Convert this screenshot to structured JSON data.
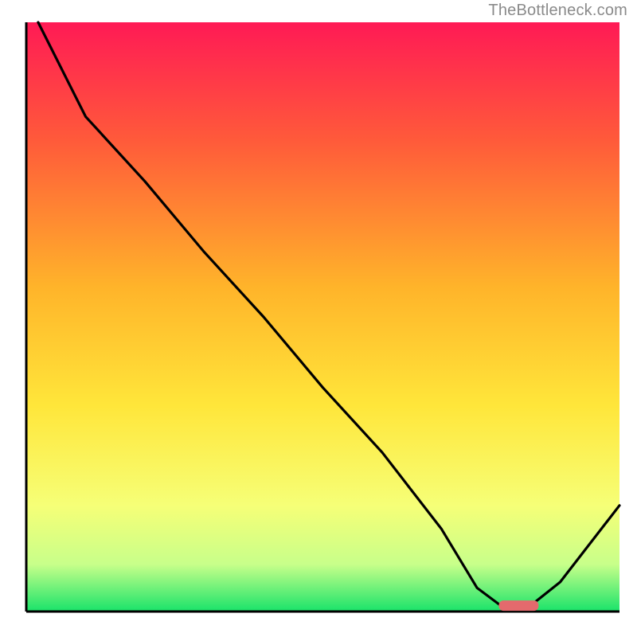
{
  "watermark": "TheBottleneck.com",
  "chart_data": {
    "type": "line",
    "title": "",
    "xlabel": "",
    "ylabel": "",
    "xlim": [
      0,
      100
    ],
    "ylim": [
      0,
      100
    ],
    "grid": false,
    "note": "Background heatmap gradient: green (bottom, good) → yellow → orange → red (top, bad). Black curve is bottleneck curve; pink marker at curve minimum.",
    "x": [
      2,
      10,
      20,
      30,
      40,
      50,
      60,
      70,
      76,
      80,
      85,
      90,
      100
    ],
    "values": [
      100,
      84,
      73,
      61,
      50,
      38,
      27,
      14,
      4,
      1,
      1,
      5,
      18
    ],
    "marker": {
      "x": 83,
      "y": 1,
      "color": "#e46a6d"
    },
    "gradient_stops": [
      {
        "pct": 0,
        "color": "#ff1a55"
      },
      {
        "pct": 20,
        "color": "#ff5a3a"
      },
      {
        "pct": 45,
        "color": "#ffb42a"
      },
      {
        "pct": 65,
        "color": "#ffe63a"
      },
      {
        "pct": 82,
        "color": "#f6ff77"
      },
      {
        "pct": 92,
        "color": "#c8ff8a"
      },
      {
        "pct": 100,
        "color": "#19e36a"
      }
    ]
  }
}
